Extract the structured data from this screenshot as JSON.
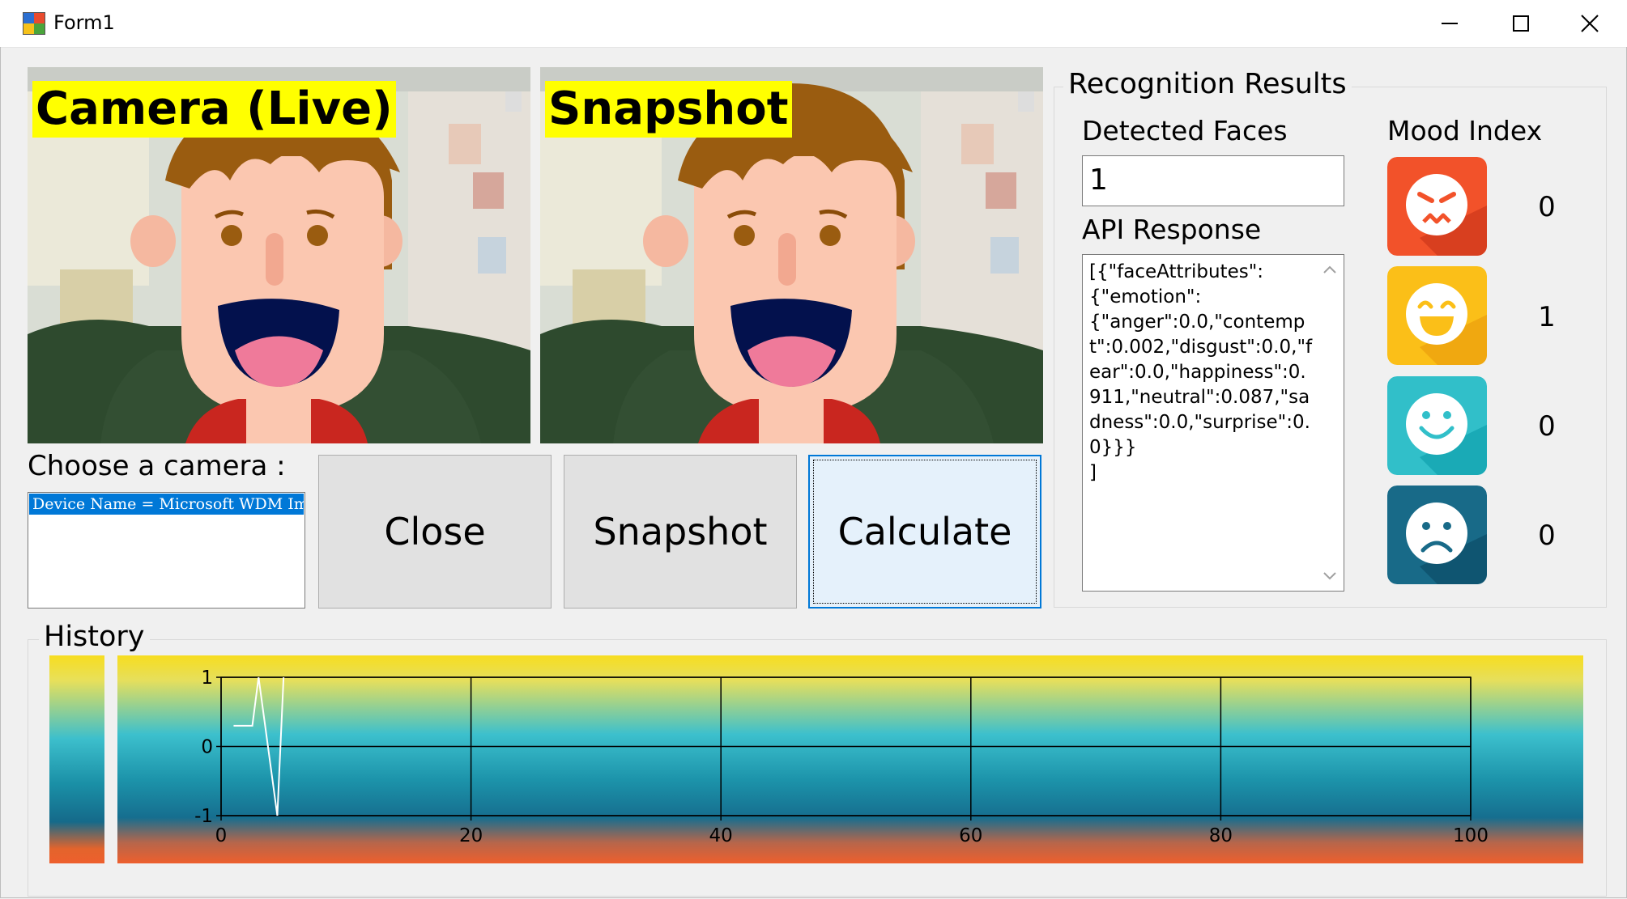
{
  "window": {
    "title": "Form1",
    "controls": [
      "minimize",
      "maximize",
      "close"
    ]
  },
  "camera_panes": {
    "live_label": "Camera (Live)",
    "snapshot_label": "Snapshot"
  },
  "camera_chooser": {
    "label": "Choose a camera :",
    "devices": [
      "Device Name = Microsoft WDM Ima"
    ],
    "selected_index": 0
  },
  "buttons": {
    "close": "Close",
    "snapshot": "Snapshot",
    "calculate": "Calculate"
  },
  "recognition": {
    "title": "Recognition Results",
    "detected_faces_label": "Detected Faces",
    "detected_faces_value": "1",
    "api_response_label": "API Response",
    "api_response": "[{\"faceAttributes\":\n{\"emotion\":\n{\"anger\":0.0,\"contempt\":0.002,\"disgust\":0.0,\"fear\":0.0,\"happiness\":0.911,\"neutral\":0.087,\"sadness\":0.0,\"surprise\":0.0}}}\n]",
    "mood_index_label": "Mood Index",
    "moods": [
      {
        "icon": "angry-face-icon",
        "color": "#f2522a",
        "value": "0"
      },
      {
        "icon": "laughing-face-icon",
        "color": "#fbbf18",
        "value": "1"
      },
      {
        "icon": "smiling-face-icon",
        "color": "#31bfc9",
        "value": "0"
      },
      {
        "icon": "sad-face-icon",
        "color": "#186a88",
        "value": "0"
      }
    ]
  },
  "history": {
    "title": "History"
  },
  "chart_data": {
    "type": "line",
    "x_ticks": [
      "0",
      "20",
      "40",
      "60",
      "80",
      "100"
    ],
    "y_ticks": [
      "1",
      "0",
      "-1"
    ],
    "xlim": [
      0,
      100
    ],
    "ylim": [
      -1,
      1
    ],
    "grid": true,
    "series": [
      {
        "x": [
          1,
          2.5,
          3,
          4.5,
          5
        ],
        "y": [
          0.3,
          0.3,
          1,
          -1,
          1
        ],
        "color": "#ffffff"
      }
    ]
  }
}
